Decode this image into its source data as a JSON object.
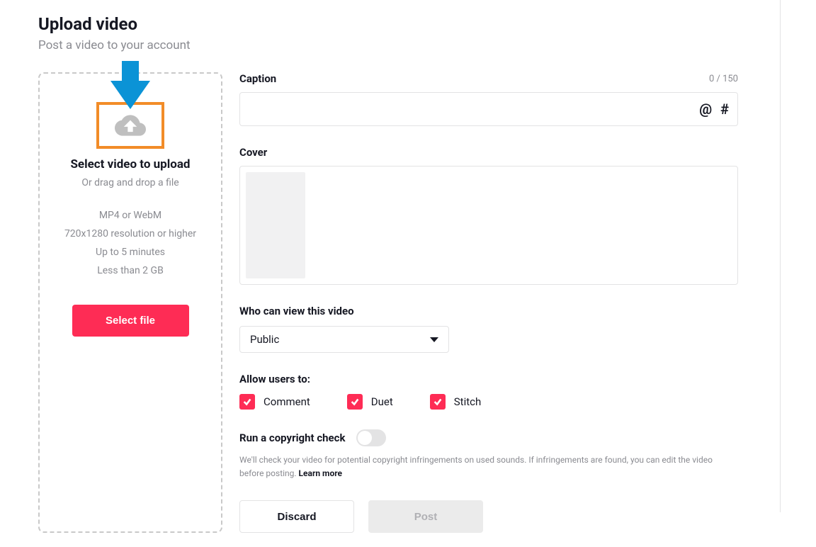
{
  "header": {
    "title": "Upload video",
    "subtitle": "Post a video to your account"
  },
  "upload_box": {
    "title": "Select video to upload",
    "subtitle": "Or drag and drop a file",
    "hints": [
      "MP4 or WebM",
      "720x1280 resolution or higher",
      "Up to 5 minutes",
      "Less than 2 GB"
    ],
    "button_label": "Select file"
  },
  "caption": {
    "label": "Caption",
    "counter": "0 / 150",
    "value": "",
    "mention_symbol": "@",
    "hashtag_symbol": "#"
  },
  "cover": {
    "label": "Cover"
  },
  "visibility": {
    "label": "Who can view this video",
    "selected": "Public"
  },
  "permissions": {
    "label": "Allow users to:",
    "options": [
      {
        "label": "Comment",
        "checked": true
      },
      {
        "label": "Duet",
        "checked": true
      },
      {
        "label": "Stitch",
        "checked": true
      }
    ]
  },
  "copyright": {
    "label": "Run a copyright check",
    "enabled": false,
    "description": "We'll check your video for potential copyright infringements on used sounds. If infringements are found, you can edit the video before posting. ",
    "learn_more": "Learn more"
  },
  "actions": {
    "discard": "Discard",
    "post": "Post"
  }
}
